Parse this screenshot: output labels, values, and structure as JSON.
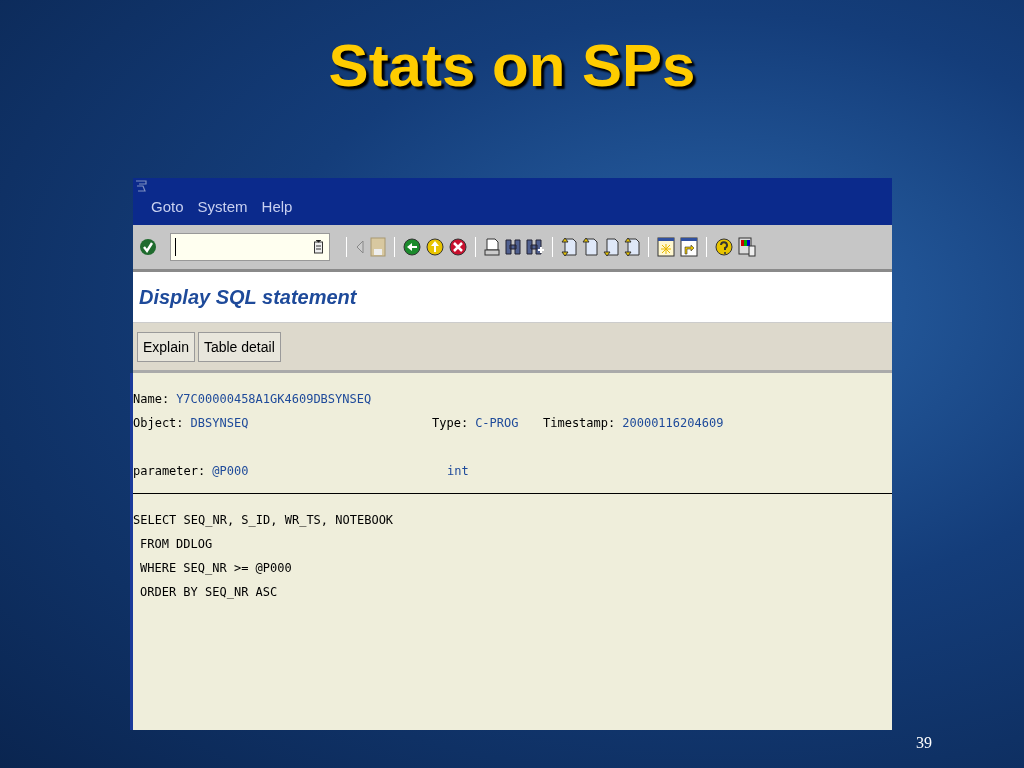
{
  "slide": {
    "title": "Stats on SPs",
    "page_number": "39"
  },
  "window": {
    "menu": [
      {
        "label": "Goto"
      },
      {
        "label": "System"
      },
      {
        "label": "Help"
      }
    ],
    "screen_title": "Display SQL statement",
    "buttons": [
      "Explain",
      "Table detail"
    ],
    "name": {
      "label": "Name:",
      "value": "Y7C00000458A1GK4609DBSYNSEQ"
    },
    "object": {
      "label": "Object:",
      "value": "DBSYNSEQ"
    },
    "type": {
      "label": "Type:",
      "value": "C-PROG"
    },
    "timestamp": {
      "label": "Timestamp:",
      "value": "20000116204609"
    },
    "parameter": {
      "label": "parameter:",
      "value": "@P000",
      "data_type": "int"
    },
    "sql": [
      {
        "text": "SELECT SEQ_NR, S_ID, WR_TS, NOTEBOOK",
        "indent": false
      },
      {
        "text": "FROM DDLOG",
        "indent": true
      },
      {
        "text": "WHERE SEQ_NR >= @P000",
        "indent": true
      },
      {
        "text": "ORDER BY SEQ_NR ASC",
        "indent": true
      }
    ]
  }
}
